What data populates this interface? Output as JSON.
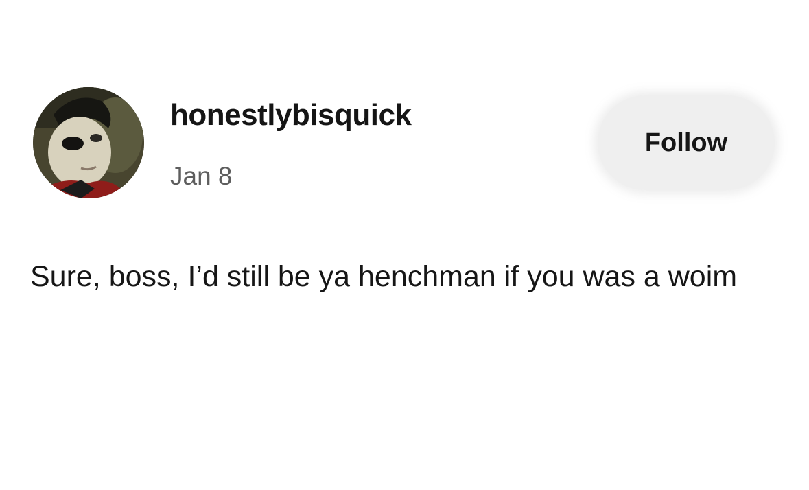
{
  "post": {
    "username": "honestlybisquick",
    "date": "Jan 8",
    "follow_label": "Follow",
    "text": "Sure, boss, I’d still be ya henchman if you was a woim"
  },
  "colors": {
    "background": "#ffffff",
    "text": "#161616",
    "muted_text": "#5e5e5e",
    "button_bg": "#efefef"
  },
  "icons": {
    "avatar": "profile-photo"
  }
}
